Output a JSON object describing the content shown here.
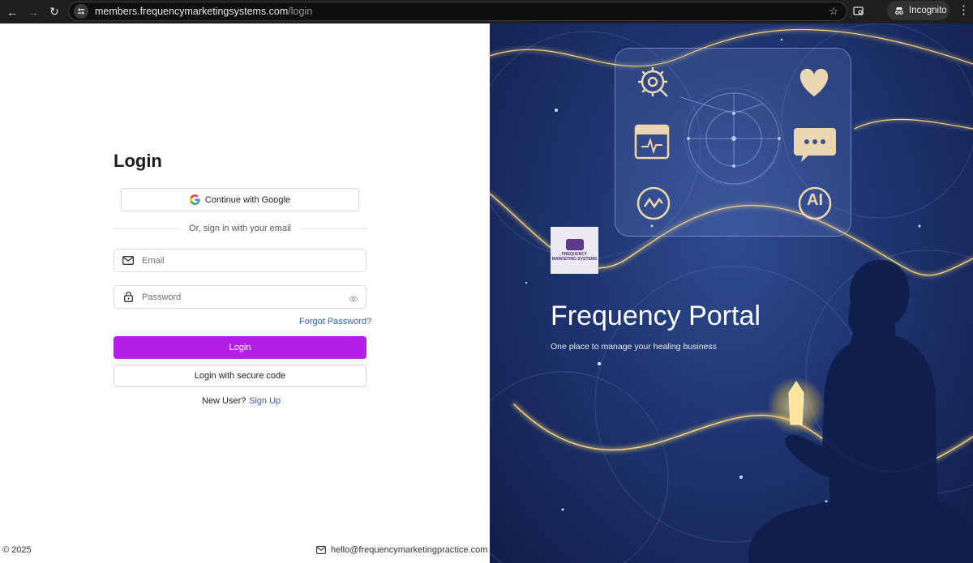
{
  "browser": {
    "url_host": "members.frequencymarketingsystems.com",
    "url_path": "/login",
    "incognito_label": "Incognito"
  },
  "login": {
    "title": "Login",
    "google_button": "Continue with Google",
    "divider_text": "Or, sign in with your email",
    "email_placeholder": "Email",
    "password_placeholder": "Password",
    "forgot_password": "Forgot Password?",
    "login_button": "Login",
    "secure_code_button": "Login with secure code",
    "new_user_text": "New User?",
    "sign_up_link": "Sign Up"
  },
  "footer": {
    "copyright": "© 2025",
    "email": "hello@frequencymarketingpractice.com"
  },
  "hero": {
    "title": "Frequency Portal",
    "subtitle": "One place to manage your healing business",
    "logo_text": "FREQUENCY MARKETING SYSTEMS",
    "ai_badge": "AI"
  },
  "colors": {
    "primary_button": "#b31fe6",
    "link": "#2a5fc4",
    "hero_bg": "#1e3470"
  }
}
